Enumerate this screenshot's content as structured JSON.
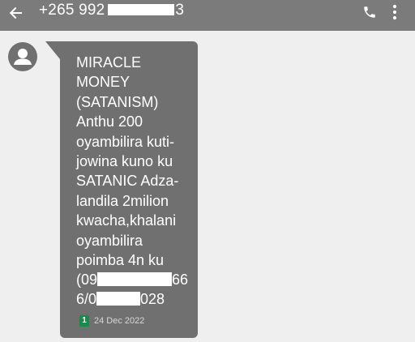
{
  "header": {
    "title_prefix": "+265 992",
    "title_suffix": "3",
    "back_icon": "arrow-back-icon",
    "call_icon": "phone-icon",
    "menu_icon": "more-vert-icon",
    "bar_color": "#7b7b7b"
  },
  "conversation": {
    "avatar_icon": "person-icon",
    "bubble_color": "#707070",
    "message": {
      "text_main": " MIRACLE\nMONEY\n(SATANISM)\nAnthu 200\noyambilira kuti-\njowina kuno ku\nSATANIC Adza-\nlandila 2milion\nkwacha,khalani\noyambilira\npoimba 4n ku",
      "line_a_prefix": "(09",
      "line_a_suffix": "66",
      "line_b_prefix": "6/0",
      "line_b_suffix": "028",
      "sim_slot": "1",
      "timestamp": "24 Dec 2022"
    }
  }
}
